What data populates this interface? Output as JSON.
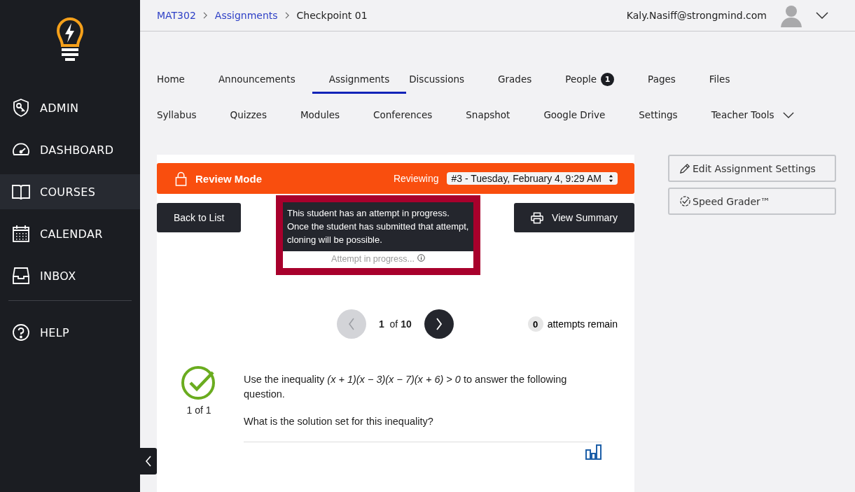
{
  "sidebar": {
    "items": [
      {
        "label": "ADMIN",
        "kind": "shield",
        "selected": false
      },
      {
        "label": "DASHBOARD",
        "kind": "gauge",
        "selected": false
      },
      {
        "label": "COURSES",
        "kind": "book",
        "selected": true
      },
      {
        "label": "CALENDAR",
        "kind": "calendar",
        "selected": false
      },
      {
        "label": "INBOX",
        "kind": "inbox",
        "selected": false
      },
      {
        "label": "HELP",
        "kind": "help",
        "selected": false
      }
    ]
  },
  "breadcrumb": [
    {
      "label": "MAT302",
      "link": true
    },
    {
      "label": "Assignments",
      "link": true
    },
    {
      "label": "Checkpoint 01",
      "link": false
    }
  ],
  "user": {
    "email": "Kaly.Nasiff@strongmind.com"
  },
  "tabs": [
    [
      {
        "label": "Home",
        "selected": false
      },
      {
        "label": "Announcements",
        "selected": false
      },
      {
        "label": "Assignments",
        "selected": true
      },
      {
        "label": "Discussions",
        "selected": false
      },
      {
        "label": "Grades",
        "selected": false
      },
      {
        "label": "People",
        "selected": false,
        "badge": "1"
      },
      {
        "label": "Pages",
        "selected": false
      },
      {
        "label": "Files",
        "selected": false
      }
    ],
    [
      {
        "label": "Syllabus",
        "selected": false
      },
      {
        "label": "Quizzes",
        "selected": false
      },
      {
        "label": "Modules",
        "selected": false
      },
      {
        "label": "Conferences",
        "selected": false
      },
      {
        "label": "Snapshot",
        "selected": false
      },
      {
        "label": "Google Drive",
        "selected": false
      },
      {
        "label": "Settings",
        "selected": false
      },
      {
        "label": "Teacher Tools",
        "selected": false,
        "dropdown": true
      }
    ]
  ],
  "review_bar": {
    "title": "Review Mode",
    "reviewing_label": "Reviewing",
    "attempt": "#3 - Tuesday, February 4, 9:29 AM"
  },
  "buttons": {
    "back": "Back to List",
    "summary": "View Summary"
  },
  "tooltip": {
    "text": "This student has an attempt in progress. Once the student has submitted that attempt, cloning will be possible.",
    "status": "Attempt in progress..."
  },
  "pager": {
    "current": "1",
    "of": "of",
    "total": "10"
  },
  "attempts": {
    "count": "0",
    "label": "attempts remain"
  },
  "question": {
    "score": "1 of 1",
    "correct": true,
    "text": "Use the inequality *(x + 1)(x − 3)(x − 7)(x + 6) > 0* to answer the following question.",
    "prompt": "What is the solution set for this inequality?"
  },
  "side_buttons": [
    "Edit Assignment Settings",
    "Speed Grader™"
  ]
}
